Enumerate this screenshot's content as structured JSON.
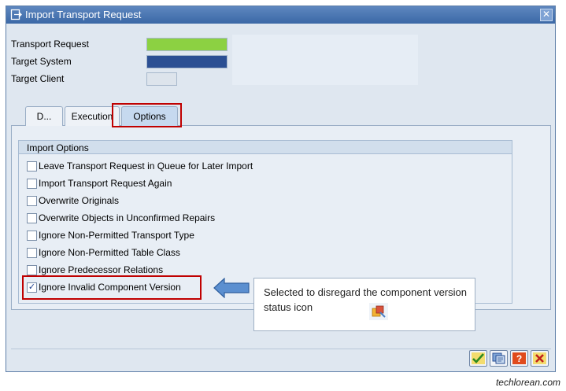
{
  "window": {
    "title": "Import Transport Request",
    "close_label": "✕"
  },
  "fields": [
    {
      "label": "Transport Request",
      "value_color": "#8cd142"
    },
    {
      "label": "Target System",
      "value_color": "#2b4f93"
    },
    {
      "label": "Target Client",
      "value_color": "#dde4ec"
    }
  ],
  "tabs": [
    {
      "label": "D..."
    },
    {
      "label": "Execution"
    },
    {
      "label": "Options",
      "active": true
    }
  ],
  "options_group": {
    "title": "Import Options",
    "items": [
      {
        "label": "Leave Transport Request in Queue for Later Import",
        "checked": false
      },
      {
        "label": "Import Transport Request Again",
        "checked": false
      },
      {
        "label": "Overwrite Originals",
        "checked": false
      },
      {
        "label": "Overwrite Objects in Unconfirmed Repairs",
        "checked": false
      },
      {
        "label": "Ignore Non-Permitted Transport Type",
        "checked": false
      },
      {
        "label": "Ignore Non-Permitted Table Class",
        "checked": false
      },
      {
        "label": "Ignore Predecessor Relations",
        "checked": false
      },
      {
        "label": "Ignore Invalid Component Version",
        "checked": true
      }
    ]
  },
  "callout": {
    "text": "Selected to disregard the component version status icon"
  },
  "footer_buttons": [
    {
      "name": "confirm",
      "icon": "checkmark-icon"
    },
    {
      "name": "copy",
      "icon": "copy-icon"
    },
    {
      "name": "help",
      "icon": "help-icon"
    },
    {
      "name": "cancel",
      "icon": "cancel-icon"
    }
  ],
  "colors": {
    "highlight": "#c00000",
    "accent": "#3b68a6"
  },
  "watermark": "techlorean.com"
}
